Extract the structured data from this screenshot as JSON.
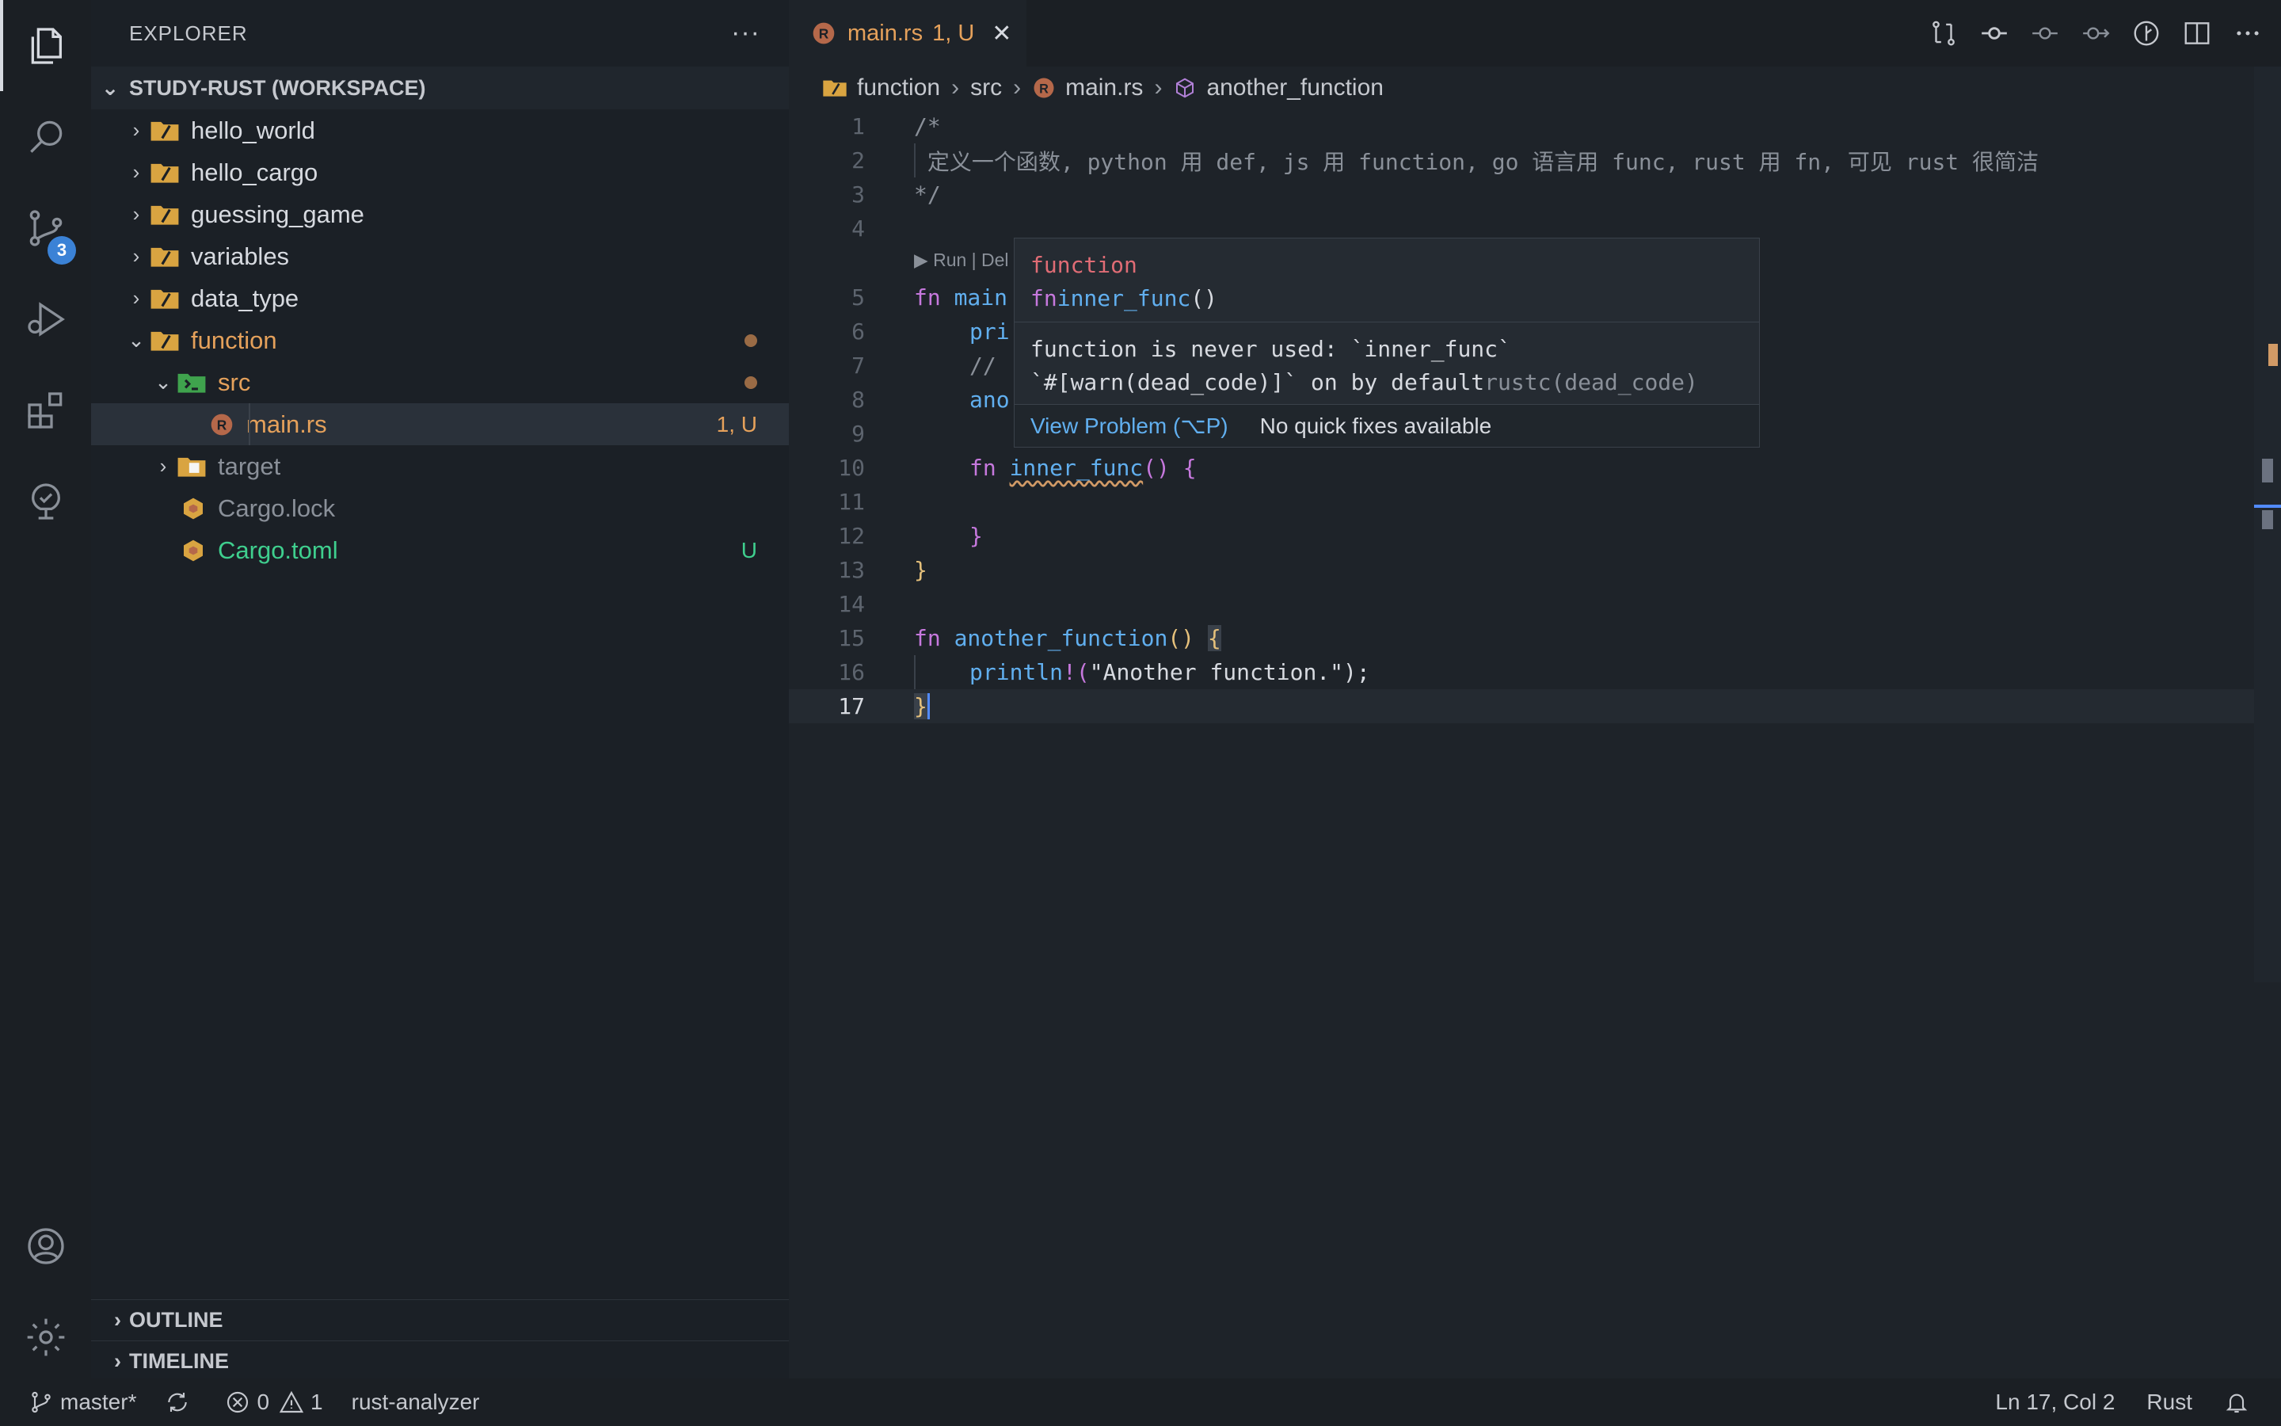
{
  "explorer": {
    "title": "EXPLORER",
    "more": "···",
    "workspace": "STUDY-RUST (WORKSPACE)",
    "items": [
      {
        "label": "hello_world",
        "color": "#d7dae0"
      },
      {
        "label": "hello_cargo",
        "color": "#d7dae0"
      },
      {
        "label": "guessing_game",
        "color": "#d7dae0"
      },
      {
        "label": "variables",
        "color": "#d7dae0"
      },
      {
        "label": "data_type",
        "color": "#d7dae0"
      },
      {
        "label": "function",
        "color": "#e5a15b"
      },
      {
        "label": "src",
        "color": "#e5a15b"
      },
      {
        "label": "main.rs",
        "color": "#e5a15b",
        "status": "1, U"
      },
      {
        "label": "target",
        "color": "#8a9099"
      },
      {
        "label": "Cargo.lock",
        "color": "#8a9099"
      },
      {
        "label": "Cargo.toml",
        "color": "#3fcf8e",
        "status": "U"
      }
    ],
    "outline": "OUTLINE",
    "timeline": "TIMELINE"
  },
  "activity": {
    "scm_badge": "3"
  },
  "tab": {
    "name": "main.rs",
    "status": "1, U",
    "close": "✕"
  },
  "breadcrumb": [
    "function",
    "src",
    "main.rs",
    "another_function"
  ],
  "editor": {
    "codelens": "▶ Run | Del",
    "lines": [
      {
        "n": "1"
      },
      {
        "n": "2"
      },
      {
        "n": "3"
      },
      {
        "n": "4"
      },
      {
        "n": "5"
      },
      {
        "n": "6"
      },
      {
        "n": "7"
      },
      {
        "n": "8"
      },
      {
        "n": "9"
      },
      {
        "n": "10"
      },
      {
        "n": "11"
      },
      {
        "n": "12"
      },
      {
        "n": "13"
      },
      {
        "n": "14"
      },
      {
        "n": "15"
      },
      {
        "n": "16"
      },
      {
        "n": "17"
      }
    ],
    "code": {
      "l1": "/*",
      "l2": " 定义一个函数, python 用 def, js 用 function, go 语言用 func, rust 用 fn, 可见 rust 很简洁",
      "l3": "*/",
      "l5_kw": "fn",
      "l5_name": "main",
      "l6": "pri",
      "l7": "//",
      "l8": "ano",
      "l10_kw": "fn",
      "l10_name": "inner_func",
      "l10_paren": "()",
      "l10_brace": "{",
      "l12": "}",
      "l13": "}",
      "l15_kw": "fn",
      "l15_name": "another_function",
      "l15_paren": "()",
      "l15_brace": "{",
      "l16_macro": "println",
      "l16_bang": "!",
      "l16_open": "(",
      "l16_str": "\"Another function.\"",
      "l16_close": ");",
      "l17": "}"
    }
  },
  "hover": {
    "kind": "function",
    "sig_kw": "fn",
    "sig_name": "inner_func",
    "sig_paren": "()",
    "msg1": "function is never used: `inner_func`",
    "msg2": "`#[warn(dead_code)]` on by default",
    "msg2_src": "rustc(dead_code)",
    "view_problem": "View Problem (⌥P)",
    "no_fixes": "No quick fixes available"
  },
  "status": {
    "branch": "master*",
    "errors": "0",
    "warnings": "1",
    "server": "rust-analyzer",
    "position": "Ln 17, Col 2",
    "language": "Rust"
  }
}
